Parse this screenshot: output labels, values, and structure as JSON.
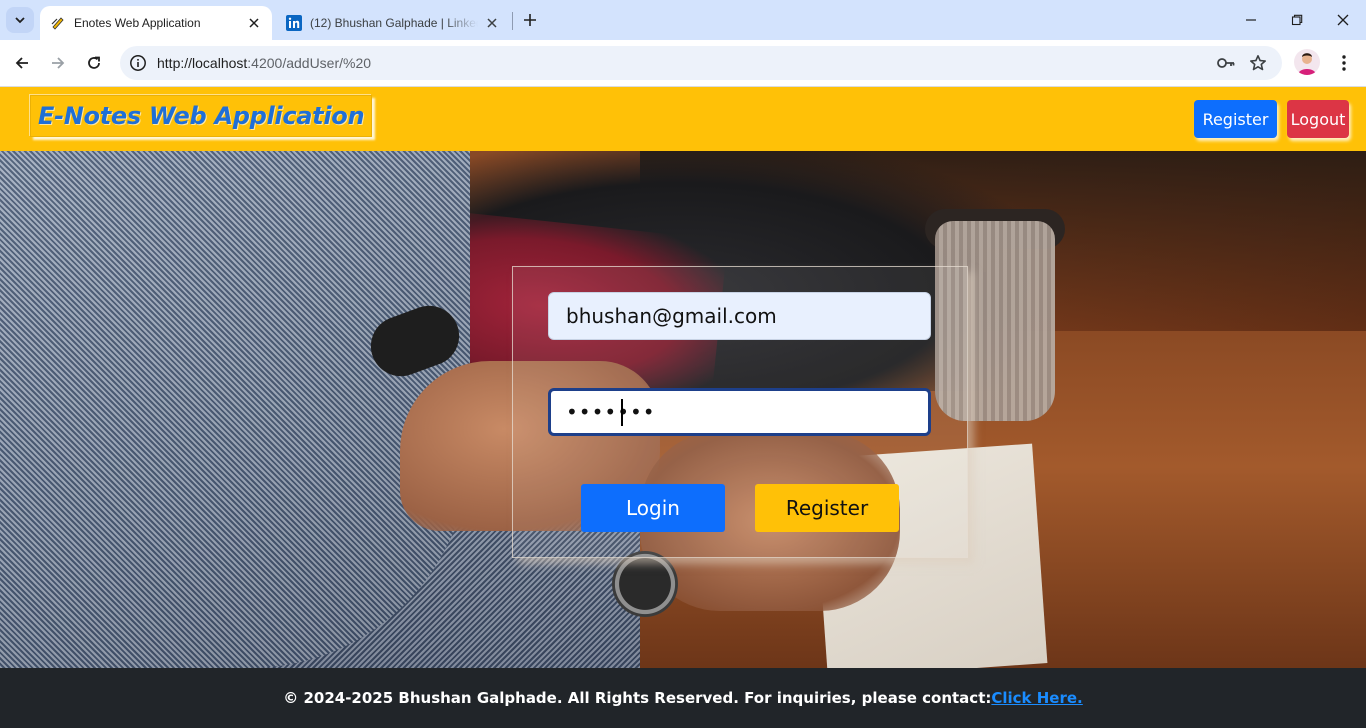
{
  "browser": {
    "tabs": [
      {
        "title": "Enotes Web Application",
        "active": true,
        "favicon": "pencil-icon"
      },
      {
        "title": "(12) Bhushan Galphade | LinkedIn",
        "active": false,
        "favicon": "linkedin-icon"
      }
    ],
    "url": "http://localhost:4200/addUser/%20",
    "url_host": "http://localhost",
    "url_rest": ":4200/addUser/%20"
  },
  "navbar": {
    "brand": "E-Notes Web Application",
    "register_label": "Register",
    "logout_label": "Logout",
    "colors": {
      "background": "#ffc107",
      "register": "#0d6efd",
      "logout": "#dc3545"
    }
  },
  "login": {
    "email_value": "bhushan@gmail.com",
    "password_mask": "•••••••",
    "login_label": "Login",
    "register_label": "Register"
  },
  "footer": {
    "text": "© 2024-2025 Bhushan Galphade. All Rights Reserved. For inquiries, please contact:",
    "link_label": "Click Here."
  }
}
